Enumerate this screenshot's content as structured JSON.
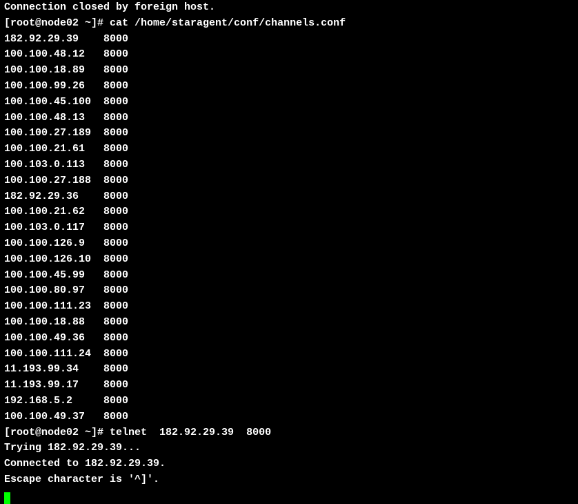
{
  "topline": "Connection closed by foreign host.",
  "prompt1_user_host": "[root@node02 ~]# ",
  "prompt1_cmd": "cat /home/staragent/conf/channels.conf",
  "channels": [
    {
      "ip": "182.92.29.39",
      "port": "8000"
    },
    {
      "ip": "100.100.48.12",
      "port": "8000"
    },
    {
      "ip": "100.100.18.89",
      "port": "8000"
    },
    {
      "ip": "100.100.99.26",
      "port": "8000"
    },
    {
      "ip": "100.100.45.100",
      "port": "8000"
    },
    {
      "ip": "100.100.48.13",
      "port": "8000"
    },
    {
      "ip": "100.100.27.189",
      "port": "8000"
    },
    {
      "ip": "100.100.21.61",
      "port": "8000"
    },
    {
      "ip": "100.103.0.113",
      "port": "8000"
    },
    {
      "ip": "100.100.27.188",
      "port": "8000"
    },
    {
      "ip": "182.92.29.36",
      "port": "8000"
    },
    {
      "ip": "100.100.21.62",
      "port": "8000"
    },
    {
      "ip": "100.103.0.117",
      "port": "8000"
    },
    {
      "ip": "100.100.126.9",
      "port": "8000"
    },
    {
      "ip": "100.100.126.10",
      "port": "8000"
    },
    {
      "ip": "100.100.45.99",
      "port": "8000"
    },
    {
      "ip": "100.100.80.97",
      "port": "8000"
    },
    {
      "ip": "100.100.111.23",
      "port": "8000"
    },
    {
      "ip": "100.100.18.88",
      "port": "8000"
    },
    {
      "ip": "100.100.49.36",
      "port": "8000"
    },
    {
      "ip": "100.100.111.24",
      "port": "8000"
    },
    {
      "ip": "11.193.99.34",
      "port": "8000"
    },
    {
      "ip": "11.193.99.17",
      "port": "8000"
    },
    {
      "ip": "192.168.5.2",
      "port": "8000"
    },
    {
      "ip": "100.100.49.37",
      "port": "8000"
    }
  ],
  "prompt2_user_host": "[root@node02 ~]# ",
  "prompt2_cmd": "telnet  182.92.29.39  8000",
  "telnet_trying": "Trying 182.92.29.39...",
  "telnet_connected": "Connected to 182.92.29.39.",
  "telnet_escape": "Escape character is '^]'."
}
